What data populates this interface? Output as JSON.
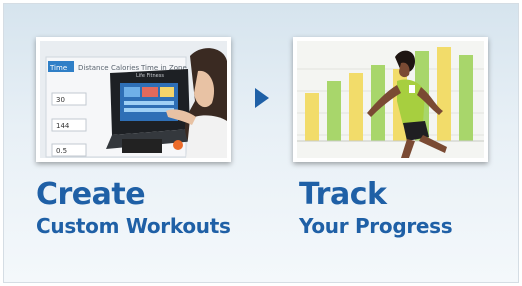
{
  "panels": [
    {
      "title": "Create",
      "subtitle": "Custom Workouts"
    },
    {
      "title": "Track",
      "subtitle": "Your Progress"
    }
  ],
  "photo1": {
    "tabs": [
      "Time",
      "Distance",
      "Calories",
      "Time in Zone"
    ],
    "rows": [
      "30",
      "144",
      "0.5"
    ],
    "brand": "Life Fitness"
  },
  "colors": {
    "accent": "#1f60a6",
    "bar_yellow": "#f2dc6a",
    "bar_green": "#a8d66b"
  }
}
